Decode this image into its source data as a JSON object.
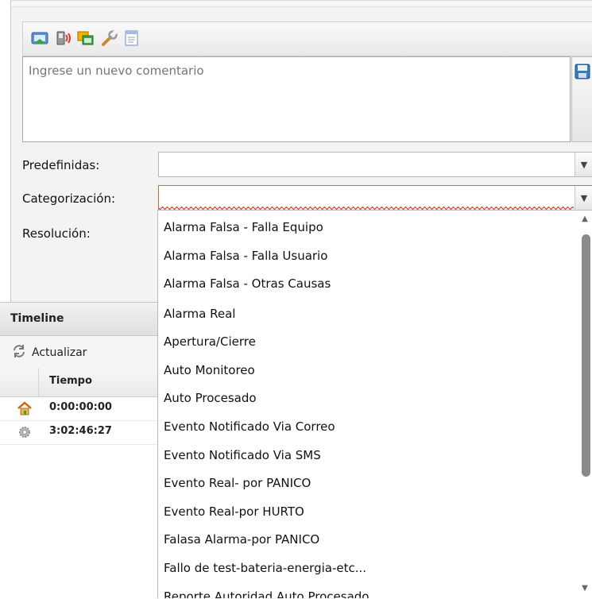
{
  "comment_panel": {
    "toolbar_icons": [
      "connect-icon",
      "phone-audio-icon",
      "windows-icon",
      "wrench-icon",
      "notepad-icon"
    ],
    "comment_placeholder": "Ingrese un nuevo comentario",
    "save_icon": "floppy-disk-icon"
  },
  "form": {
    "predefinidas_label": "Predefinidas:",
    "categorizacion_label": "Categorización:",
    "resolucion_label": "Resolución:",
    "predefinidas_value": "",
    "categorizacion_value": ""
  },
  "timeline": {
    "title": "Timeline",
    "refresh_label": "Actualizar",
    "column_time": "Tiempo",
    "rows": [
      {
        "icon": "home-icon",
        "time": "0:00:00:00"
      },
      {
        "icon": "gear-icon",
        "time": "3:02:46:27"
      }
    ]
  },
  "dropdown": {
    "items": [
      "Alarma Falsa - Falla Equipo",
      "Alarma Falsa - Falla Usuario",
      "Alarma Falsa - Otras Causas",
      "Alarma Real",
      "Apertura/Cierre",
      "Auto Monitoreo",
      "Auto Procesado",
      "Evento Notificado Via Correo",
      "Evento Notificado Via SMS",
      "Evento Real- por PANICO",
      "Evento Real-por HURTO",
      "Falasa Alarma-por PANICO",
      "Fallo de test-bateria-energia-etc...",
      "Reporte Autoridad Auto Procesado"
    ]
  },
  "colors": {
    "invalid_border": "#e0653a",
    "scroll_thumb": "#8a8a8a"
  }
}
